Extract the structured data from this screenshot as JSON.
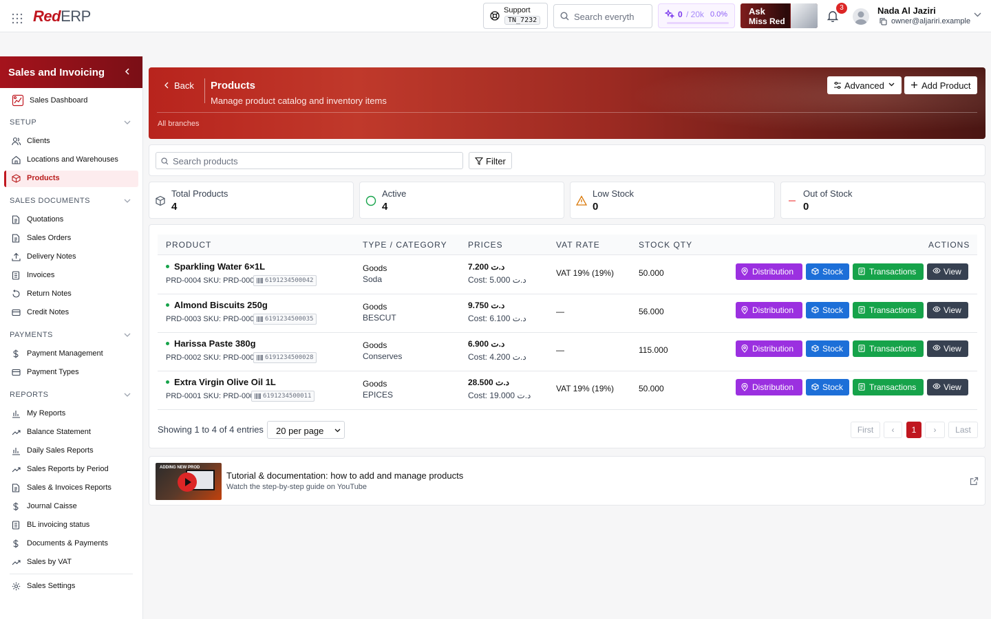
{
  "header": {
    "logo_red": "Red",
    "logo_erp": "ERP",
    "support_label": "Support",
    "support_code": "TN_7232",
    "search_placeholder": "Search everyth",
    "usage_count": "0",
    "usage_max": "/ 20k",
    "usage_percent": "0.0%",
    "ask_line1": "Ask",
    "ask_line2": "Miss Red",
    "notifications": "3",
    "user_name": "Nada Al Jaziri",
    "user_email": "owner@aljariri.example"
  },
  "sidebar": {
    "title": "Sales and Invoicing",
    "dashboard": "Sales Dashboard",
    "sections": {
      "setup": "SETUP",
      "sales_documents": "SALES DOCUMENTS",
      "payments": "PAYMENTS",
      "reports": "REPORTS"
    },
    "setup_items": [
      "Clients",
      "Locations and Warehouses",
      "Products"
    ],
    "document_items": [
      "Quotations",
      "Sales Orders",
      "Delivery Notes",
      "Invoices",
      "Return Notes",
      "Credit Notes"
    ],
    "payment_items": [
      "Payment Management",
      "Payment Types"
    ],
    "report_items": [
      "My Reports",
      "Balance Statement",
      "Daily Sales Reports",
      "Sales Reports by Period",
      "Sales & Invoices Reports",
      "Journal Caisse",
      "BL invoicing status",
      "Documents & Payments",
      "Sales by VAT"
    ],
    "settings": "Sales Settings"
  },
  "banner": {
    "back": "Back",
    "title": "Products",
    "subtitle": "Manage product catalog and inventory items",
    "branch": "All branches",
    "advanced": "Advanced",
    "add_product": "Add Product"
  },
  "toolbar": {
    "search_placeholder": "Search products",
    "filter": "Filter"
  },
  "stats": [
    {
      "label": "Total Products",
      "value": "4"
    },
    {
      "label": "Active",
      "value": "4"
    },
    {
      "label": "Low Stock",
      "value": "0"
    },
    {
      "label": "Out of Stock",
      "value": "0"
    }
  ],
  "table": {
    "columns": [
      "PRODUCT",
      "TYPE / CATEGORY",
      "PRICES",
      "VAT RATE",
      "STOCK QTY",
      "ACTIONS"
    ],
    "actions": {
      "distribution": "Distribution",
      "stock": "Stock",
      "transactions": "Transactions",
      "view": "View"
    },
    "rows": [
      {
        "name": "Sparkling Water 6×1L",
        "ref": "PRD-0004  SKU: PRD-0004",
        "barcode": "6191234500042",
        "type": "Goods",
        "category": "Soda",
        "price": "7.200 د.ت",
        "cost": "Cost: 5.000 د.ت",
        "vat": "VAT 19% (19%)",
        "qty": "50.000"
      },
      {
        "name": "Almond Biscuits 250g",
        "ref": "PRD-0003  SKU: PRD-0003",
        "barcode": "6191234500035",
        "type": "Goods",
        "category": "BESCUT",
        "price": "9.750 د.ت",
        "cost": "Cost: 6.100 د.ت",
        "vat": "—",
        "qty": "56.000"
      },
      {
        "name": "Harissa Paste 380g",
        "ref": "PRD-0002  SKU: PRD-0002",
        "barcode": "6191234500028",
        "type": "Goods",
        "category": "Conserves",
        "price": "6.900 د.ت",
        "cost": "Cost: 4.200 د.ت",
        "vat": "—",
        "qty": "115.000"
      },
      {
        "name": "Extra Virgin Olive Oil 1L",
        "ref": "PRD-0001  SKU: PRD-0001",
        "barcode": "6191234500011",
        "type": "Goods",
        "category": "EPICES",
        "price": "28.500 د.ت",
        "cost": "Cost: 19.000 د.ت",
        "vat": "VAT 19% (19%)",
        "qty": "50.000"
      }
    ]
  },
  "pagination": {
    "showing": "Showing 1 to 4 of 4 entries",
    "per_page": "20 per page",
    "first": "First",
    "prev": "‹",
    "current": "1",
    "next": "›",
    "last": "Last"
  },
  "tutorial": {
    "thumb_text": "ADDING NEW PROD",
    "title": "Tutorial & documentation: how to add and manage products",
    "subtitle": "Watch the step-by-step guide on YouTube"
  },
  "colors": {
    "brand": "#c0161f",
    "distribution": "#9b30e0",
    "stock": "#1d6fd8",
    "transactions": "#16a34a",
    "view": "#374151"
  }
}
